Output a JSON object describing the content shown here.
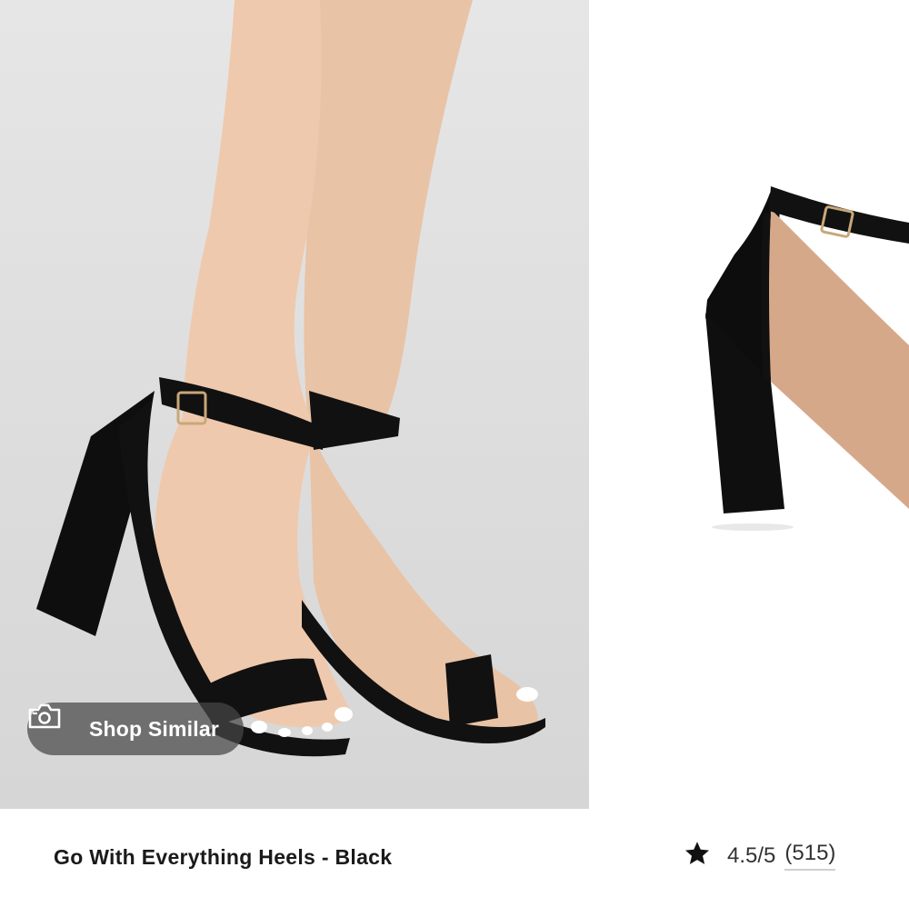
{
  "gallery": {
    "images": [
      {
        "alt": ""
      },
      {
        "alt": ""
      }
    ],
    "shop_similar": {
      "label": "Shop Similar",
      "icon": "camera-icon"
    }
  },
  "product": {
    "title": "Go With Everything Heels - Black",
    "rating": {
      "icon": "star-icon",
      "score": "4.5/5",
      "count": "(515)"
    }
  },
  "colors": {
    "pill_bg": "#464646",
    "text": "#1a1a1a",
    "star": "#111111"
  }
}
